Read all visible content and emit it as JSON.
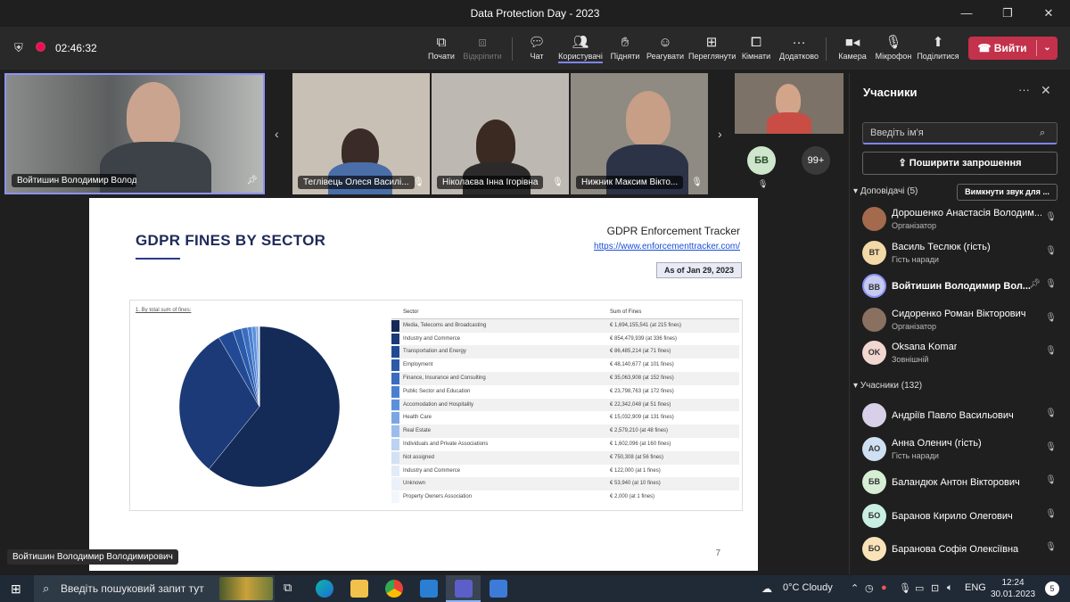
{
  "window": {
    "title": "Data Protection Day - 2023",
    "minimize": "—",
    "maximize": "❐",
    "close": "✕"
  },
  "meeting": {
    "timer": "02:46:32"
  },
  "toolbar": {
    "items": [
      {
        "label": "Почати",
        "icon": "present-icon"
      },
      {
        "label": "Відкріпити",
        "icon": "unpin-icon"
      },
      {
        "label": "Чат",
        "icon": "chat-icon"
      },
      {
        "label": "Користувачі",
        "icon": "people-icon"
      },
      {
        "label": "Підняти",
        "icon": "raise-hand-icon"
      },
      {
        "label": "Реагувати",
        "icon": "react-icon"
      },
      {
        "label": "Переглянути",
        "icon": "view-icon"
      },
      {
        "label": "Кімнати",
        "icon": "rooms-icon"
      },
      {
        "label": "Додатково",
        "icon": "more-icon"
      },
      {
        "label": "Камера",
        "icon": "camera-icon"
      },
      {
        "label": "Мікрофон",
        "icon": "mic-off-icon"
      },
      {
        "label": "Поділитися",
        "icon": "share-icon"
      }
    ],
    "leave_label": "Вийти"
  },
  "videos": [
    {
      "name": "Войтишин Володимир Володимирович"
    },
    {
      "name": "Теглівець Олеся Василі..."
    },
    {
      "name": "Ніколаєва Інна Ігорівна"
    },
    {
      "name": "Нижник Максим Вікто..."
    }
  ],
  "overflow": {
    "avatar_initials": "БВ",
    "more_count": "99+"
  },
  "slide": {
    "title": "GDPR FINES BY SECTOR",
    "tracker_title": "GDPR Enforcement Tracker",
    "tracker_url": "https://www.enforcementtracker.com/",
    "as_of": "As of Jan 29, 2023",
    "caption": "1. By total sum of fines:",
    "page_number": "7",
    "col_sector": "Sector",
    "col_fines": "Sum of Fines"
  },
  "chart_data": {
    "type": "pie",
    "title": "",
    "unit": "EUR",
    "categories": [
      "Media, Telecoms and Broadcasting",
      "Industry and Commerce",
      "Transportation and Energy",
      "Employment",
      "Finance, Insurance and Consulting",
      "Public Sector and Education",
      "Accomodation and Hospitality",
      "Health Care",
      "Real Estate",
      "Individuals and Private Associations",
      "Not assigned",
      "Industry and Commerce",
      "Unknown",
      "Property Owners Association"
    ],
    "values": [
      1694155541,
      854479939,
      86485214,
      48140677,
      35063908,
      23798763,
      22342048,
      15032909,
      2579210,
      1602096,
      750308,
      122000,
      53940,
      2000
    ],
    "labels": [
      "€ 1,694,155,541 (at 215 fines)",
      "€ 854,479,939 (at 336 fines)",
      "€ 86,485,214 (at 71 fines)",
      "€ 48,140,677 (at 101 fines)",
      "€ 35,063,908 (at 152 fines)",
      "€ 23,798,763 (at 172 fines)",
      "€ 22,342,048 (at 51 fines)",
      "€ 15,032,909 (at 131 fines)",
      "€ 2,579,210 (at 48 fines)",
      "€ 1,602,096 (at 160 fines)",
      "€ 750,308 (at 56 fines)",
      "€ 122,000 (at 1 fines)",
      "€ 53,940 (at 10 fines)",
      "€ 2,000 (at 1 fines)"
    ],
    "colors": [
      "#142a57",
      "#1c3a78",
      "#224a94",
      "#2b5aa8",
      "#3a6cc0",
      "#4a7fd0",
      "#5b91dc",
      "#7aa7e4",
      "#9cbdeb",
      "#bcd2f1",
      "#d3e1f5",
      "#e1eaf7",
      "#ebf1fa",
      "#f3f6fc"
    ]
  },
  "presenter_label": "Войтишин Володимир Володимирович",
  "panel": {
    "title": "Учасники",
    "search_placeholder": "Введіть ім'я",
    "share_invite": "Поширити запрошення",
    "presenters_header": "Доповідачі (5)",
    "mute_all": "Вимкнути звук для ...",
    "attendees_header": "Учасники (132)",
    "presenters": [
      {
        "initials": "",
        "name": "Дорошенко Анастасія Володим...",
        "role": "Організатор",
        "avatar_color": "#a36a4e"
      },
      {
        "initials": "ВТ",
        "name": "Василь Теслюк (гість)",
        "role": "Гість наради",
        "avatar_color": "#f3d9a6"
      },
      {
        "initials": "ВВ",
        "name": "Войтишин Володимир Вол...",
        "role": "",
        "avatar_color": "#c5cbef"
      },
      {
        "initials": "",
        "name": "Сидоренко Роман Вікторович",
        "role": "Організатор",
        "avatar_color": "#8a7060"
      },
      {
        "initials": "OK",
        "name": "Oksana Komar",
        "role": "Зовнішній",
        "avatar_color": "#f2d6d0"
      }
    ],
    "attendees": [
      {
        "initials": "",
        "name": "Андріїв Павло Васильович",
        "role": "",
        "avatar_color": "#d8d0e8"
      },
      {
        "initials": "АО",
        "name": "Анна Оленич (гість)",
        "role": "Гість наради",
        "avatar_color": "#cfe0f2"
      },
      {
        "initials": "БВ",
        "name": "Баландюк Антон Вікторович",
        "role": "",
        "avatar_color": "#d6eed3"
      },
      {
        "initials": "БО",
        "name": "Баранов Кирило Олегович",
        "role": "",
        "avatar_color": "#c9efe3"
      },
      {
        "initials": "БО",
        "name": "Баранова Софія Олексіївна",
        "role": "",
        "avatar_color": "#fbe3b9"
      }
    ]
  },
  "taskbar": {
    "search_placeholder": "Введіть пошуковий запит тут",
    "weather": "0°C  Cloudy",
    "language": "ENG",
    "time": "12:24",
    "date": "30.01.2023",
    "notification_count": "5"
  }
}
